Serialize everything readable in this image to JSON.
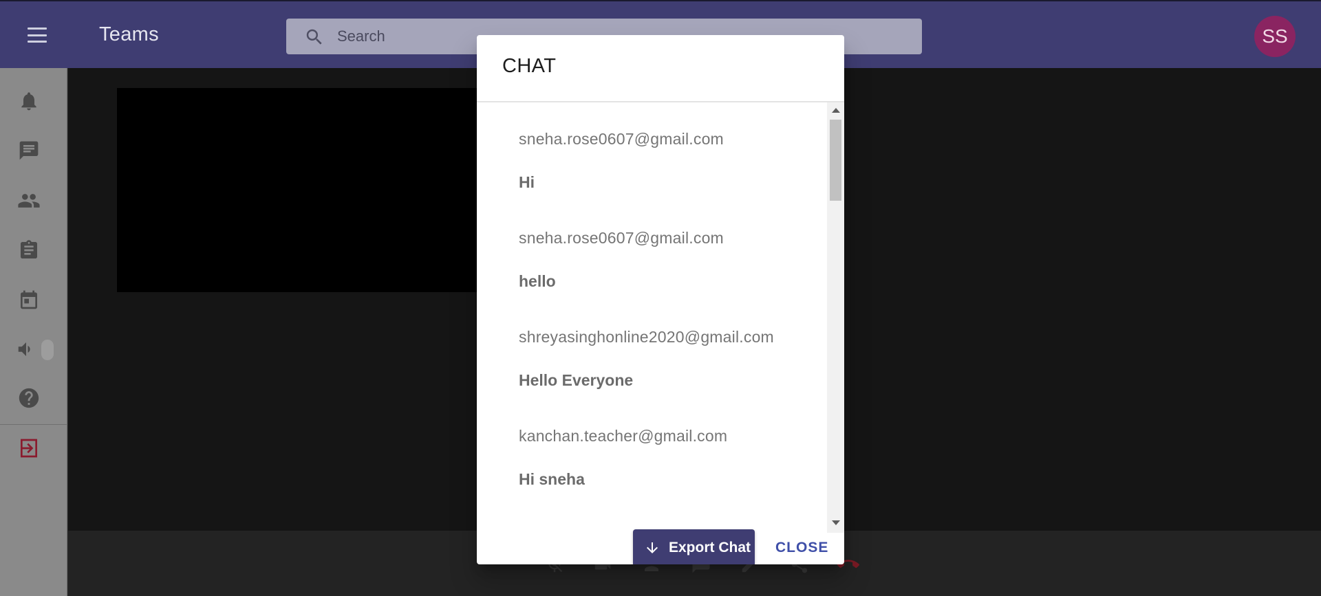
{
  "app": {
    "title": "Teams",
    "search": {
      "placeholder": "Search",
      "value": ""
    },
    "avatar_initials": "SS",
    "colors": {
      "appbar": "#3f3d72",
      "avatar": "#8a2461",
      "accent": "#3f4fa8"
    }
  },
  "sidebar": {
    "items": [
      {
        "icon": "bell-icon"
      },
      {
        "icon": "chat-icon"
      },
      {
        "icon": "people-icon"
      },
      {
        "icon": "clipboard-icon"
      },
      {
        "icon": "calendar-icon"
      },
      {
        "icon": "volume-icon"
      },
      {
        "icon": "help-icon"
      },
      {
        "icon": "exit-icon"
      }
    ]
  },
  "controls": {
    "items": [
      {
        "icon": "mic-off-icon"
      },
      {
        "icon": "camera-icon"
      },
      {
        "icon": "participants-icon"
      },
      {
        "icon": "chat-icon"
      },
      {
        "icon": "pen-icon"
      },
      {
        "icon": "share-icon"
      },
      {
        "icon": "end-call-icon"
      }
    ]
  },
  "dialog": {
    "title": "CHAT",
    "messages": [
      {
        "sender": "sneha.rose0607@gmail.com",
        "text": "Hi"
      },
      {
        "sender": "sneha.rose0607@gmail.com",
        "text": "hello"
      },
      {
        "sender": "shreyasinghonline2020@gmail.com",
        "text": "Hello Everyone"
      },
      {
        "sender": "kanchan.teacher@gmail.com",
        "text": "Hi sneha"
      }
    ],
    "export_label": "Export Chat",
    "close_label": "CLOSE"
  }
}
